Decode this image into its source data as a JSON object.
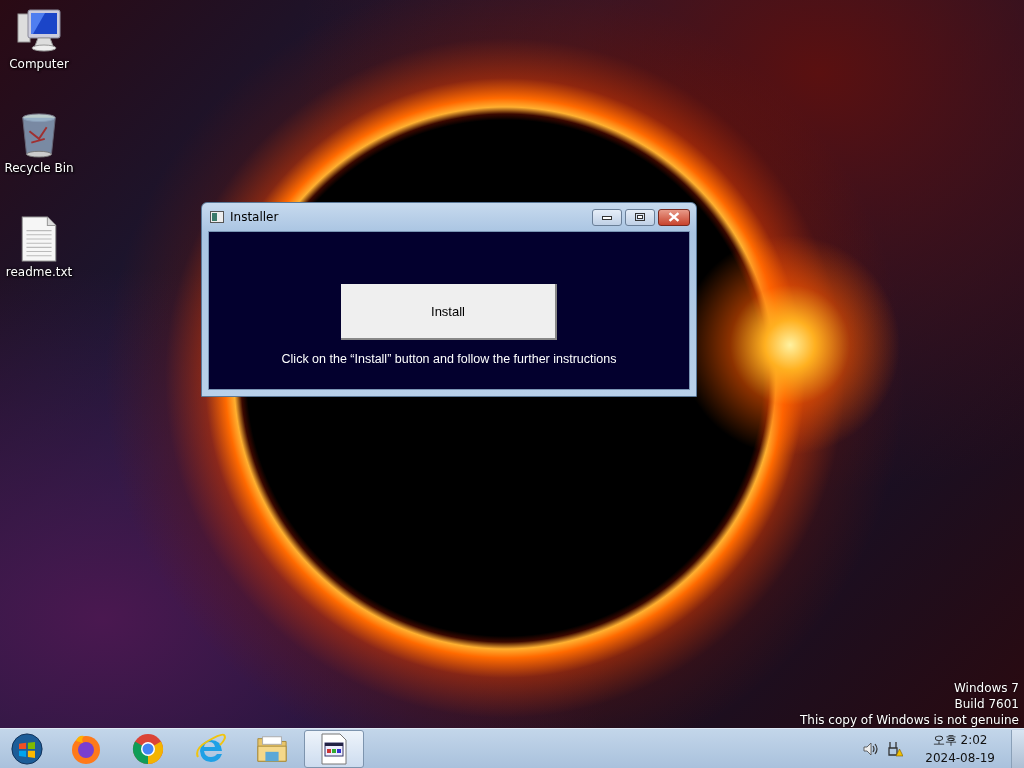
{
  "desktop_icons": [
    {
      "kind": "computer",
      "label": "Computer"
    },
    {
      "kind": "recycle",
      "label": "Recycle Bin"
    },
    {
      "kind": "textfile",
      "label": "readme.txt"
    }
  ],
  "window": {
    "title": "Installer",
    "install_button": "Install",
    "instruction": "Click on the “Install” button and follow the further instructions"
  },
  "watermark_notice": [
    "Windows 7",
    "Build 7601",
    "This copy of Windows is not genuine"
  ],
  "taskbar": {
    "items": [
      {
        "kind": "start",
        "active": false
      },
      {
        "kind": "firefox",
        "active": false
      },
      {
        "kind": "chrome",
        "active": false
      },
      {
        "kind": "ie",
        "active": false
      },
      {
        "kind": "explorer",
        "active": false
      },
      {
        "kind": "installer",
        "active": true
      }
    ],
    "tray": {
      "time": "오후 2:02",
      "date": "2024-08-19"
    }
  }
}
